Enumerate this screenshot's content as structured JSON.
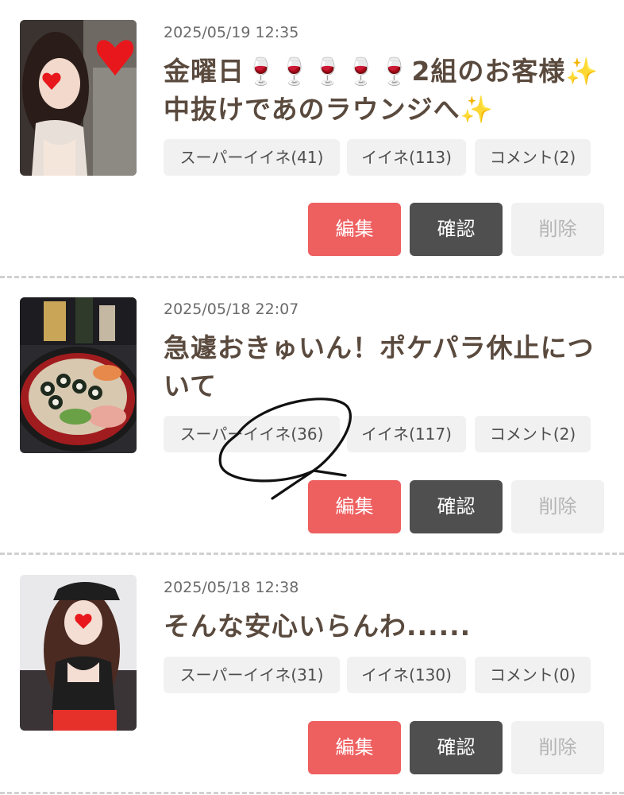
{
  "colors": {
    "title_text": "#5a4a3e",
    "edit_button": "#ee5f60",
    "confirm_button": "#4f4f4f",
    "delete_button_bg": "#f1f1f1",
    "chip_bg": "#f1f1f1",
    "divider": "#d0d0d0"
  },
  "labels": {
    "edit": "編集",
    "confirm": "確認",
    "delete": "削除"
  },
  "posts": [
    {
      "timestamp": "2025/05/19 12:35",
      "title_line1": "金曜日🍷🍷🍷🍷🍷2組のお客様✨",
      "title_line2": "中抜けであのラウンジへ✨",
      "super_likes": "スーパーイイネ(41)",
      "likes": "イイネ(113)",
      "comments": "コメント(2)",
      "thumbnail_icon": "photo-woman-with-man-heart-sticker"
    },
    {
      "timestamp": "2025/05/18 22:07",
      "title_line1": "急遽おきゅいん！ポケパラ休止につ",
      "title_line2": "いて",
      "super_likes": "スーパーイイネ(36)",
      "likes": "イイネ(117)",
      "comments": "コメント(2)",
      "thumbnail_icon": "photo-sushi-platter"
    },
    {
      "timestamp": "2025/05/18 12:38",
      "title_line1": "そんな安心いらんわ......",
      "title_line2": "",
      "super_likes": "スーパーイイネ(31)",
      "likes": "イイネ(130)",
      "comments": "コメント(0)",
      "thumbnail_icon": "photo-woman-black-cap"
    }
  ]
}
